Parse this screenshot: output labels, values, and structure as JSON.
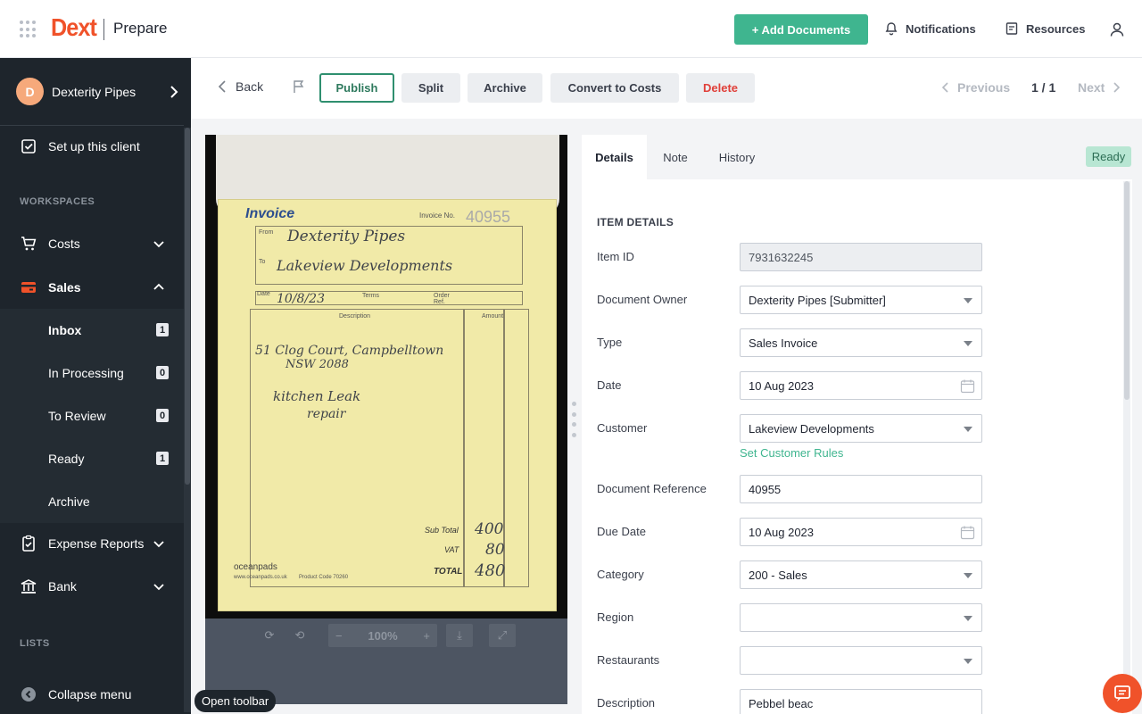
{
  "header": {
    "logo": "Dext",
    "product": "Prepare",
    "add_documents": "+ Add Documents",
    "notifications": "Notifications",
    "resources": "Resources"
  },
  "sidebar": {
    "client_initial": "D",
    "client_name": "Dexterity Pipes",
    "setup": "Set up this client",
    "workspaces_label": "WORKSPACES",
    "costs": "Costs",
    "sales": "Sales",
    "sales_items": [
      {
        "label": "Inbox",
        "count": "1"
      },
      {
        "label": "In Processing",
        "count": "0"
      },
      {
        "label": "To Review",
        "count": "0"
      },
      {
        "label": "Ready",
        "count": "1"
      },
      {
        "label": "Archive",
        "count": ""
      }
    ],
    "expense_reports": "Expense Reports",
    "bank": "Bank",
    "lists_label": "LISTS",
    "collapse": "Collapse menu"
  },
  "toolbar": {
    "back": "Back",
    "publish": "Publish",
    "split": "Split",
    "archive": "Archive",
    "convert": "Convert to Costs",
    "delete": "Delete",
    "previous": "Previous",
    "page": "1 / 1",
    "next": "Next"
  },
  "viewer": {
    "invoice_title": "Invoice",
    "invoice_no_label": "Invoice No.",
    "invoice_no": "40955",
    "from_label": "From",
    "from_value": "Dexterity Pipes",
    "to_label": "To",
    "to_value": "Lakeview Developments",
    "date_label": "Date",
    "date_value": "10/8/23",
    "terms_label": "Terms",
    "order_label": "Order Ref.",
    "desc_header": "Description",
    "amount_header": "Amount",
    "desc_line1": "51 Clog Court, Campbelltown",
    "desc_line2": "NSW 2088",
    "desc_line3": "kitchen Leak",
    "desc_line4": "repair",
    "subtotal_label": "Sub Total",
    "subtotal": "400",
    "vat_label": "VAT",
    "vat": "80",
    "total_label": "TOTAL",
    "total": "480",
    "brand": "oceanpads",
    "brand_url": "www.oceanpads.co.uk",
    "product_code": "Product Code 70260",
    "zoom": "100%",
    "open_toolbar": "Open toolbar"
  },
  "details": {
    "tabs": [
      "Details",
      "Note",
      "History"
    ],
    "status": "Ready",
    "section_title": "ITEM DETAILS",
    "fields": {
      "item_id": {
        "label": "Item ID",
        "value": "7931632245"
      },
      "owner": {
        "label": "Document Owner",
        "value": "Dexterity Pipes [Submitter]"
      },
      "type": {
        "label": "Type",
        "value": "Sales Invoice"
      },
      "date": {
        "label": "Date",
        "value": "10 Aug 2023"
      },
      "customer": {
        "label": "Customer",
        "value": "Lakeview Developments"
      },
      "customer_rules": "Set Customer Rules",
      "reference": {
        "label": "Document Reference",
        "value": "40955"
      },
      "due_date": {
        "label": "Due Date",
        "value": "10 Aug 2023"
      },
      "category": {
        "label": "Category",
        "value": "200 - Sales"
      },
      "region": {
        "label": "Region",
        "value": ""
      },
      "restaurants": {
        "label": "Restaurants",
        "value": ""
      },
      "description": {
        "label": "Description",
        "value": "Pebbel beac"
      }
    }
  },
  "colors": {
    "brand_orange": "#f0522a",
    "accent_green": "#3fb58f",
    "sidebar_bg": "#1e252c",
    "delete_red": "#e0403a"
  }
}
